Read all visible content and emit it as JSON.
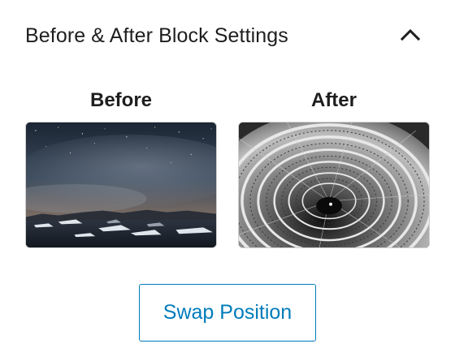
{
  "panel": {
    "title": "Before & After Block Settings",
    "collapse_icon": "chevron-up-icon"
  },
  "before": {
    "label": "Before",
    "image": "night-sky-glacier-lagoon-image"
  },
  "after": {
    "label": "After",
    "image": "spiral-staircase-black-white-image"
  },
  "swap_button": {
    "label": "Swap Position"
  },
  "colors": {
    "accent": "#007cba",
    "text": "#1e1e1e",
    "thumb_border": "#cfcfcf"
  }
}
